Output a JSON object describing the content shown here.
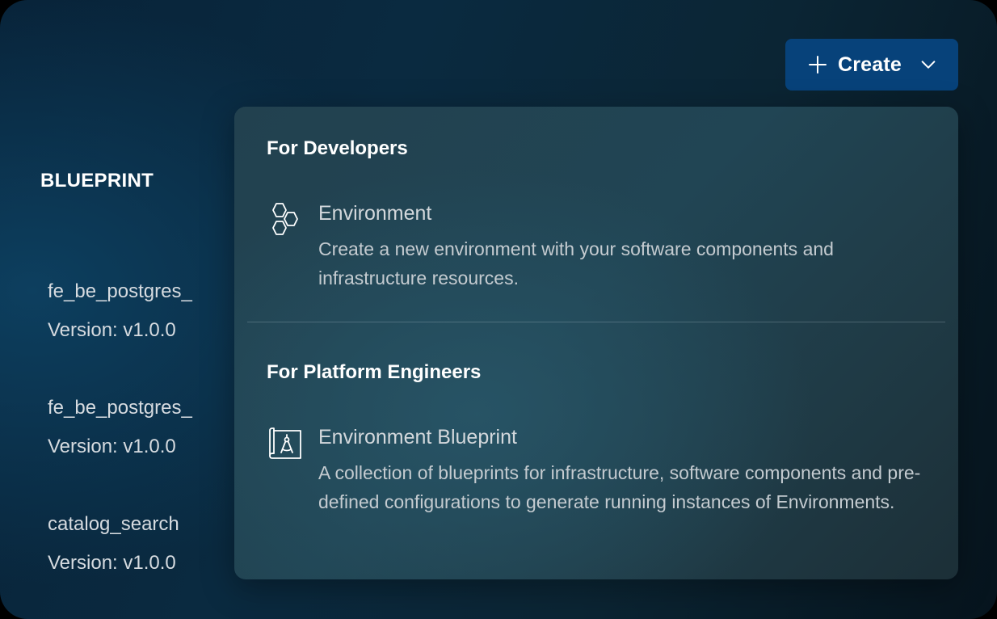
{
  "toolbar": {
    "create_label": "Create",
    "create_icon": "plus-icon",
    "dropdown_icon": "chevron-down-icon",
    "create_color": "#07427a"
  },
  "list": {
    "heading": "BLUEPRINT",
    "items": [
      {
        "name": "fe_be_postgres_",
        "version": "Version: v1.0.0"
      },
      {
        "name": "fe_be_postgres_",
        "version": "Version: v1.0.0"
      },
      {
        "name": "catalog_search",
        "version": "Version: v1.0.0"
      }
    ]
  },
  "menu": {
    "sections": [
      {
        "title": "For Developers",
        "options": [
          {
            "icon": "hexagons-icon",
            "title": "Environment",
            "description": "Create a new environment with your software components and infrastructure resources."
          }
        ]
      },
      {
        "title": "For Platform Engineers",
        "options": [
          {
            "icon": "blueprint-icon",
            "title": "Environment Blueprint",
            "description": "A collection of blueprints for infrastructure, software components and pre-defined configurations to generate running instances of Environments."
          }
        ]
      }
    ]
  }
}
